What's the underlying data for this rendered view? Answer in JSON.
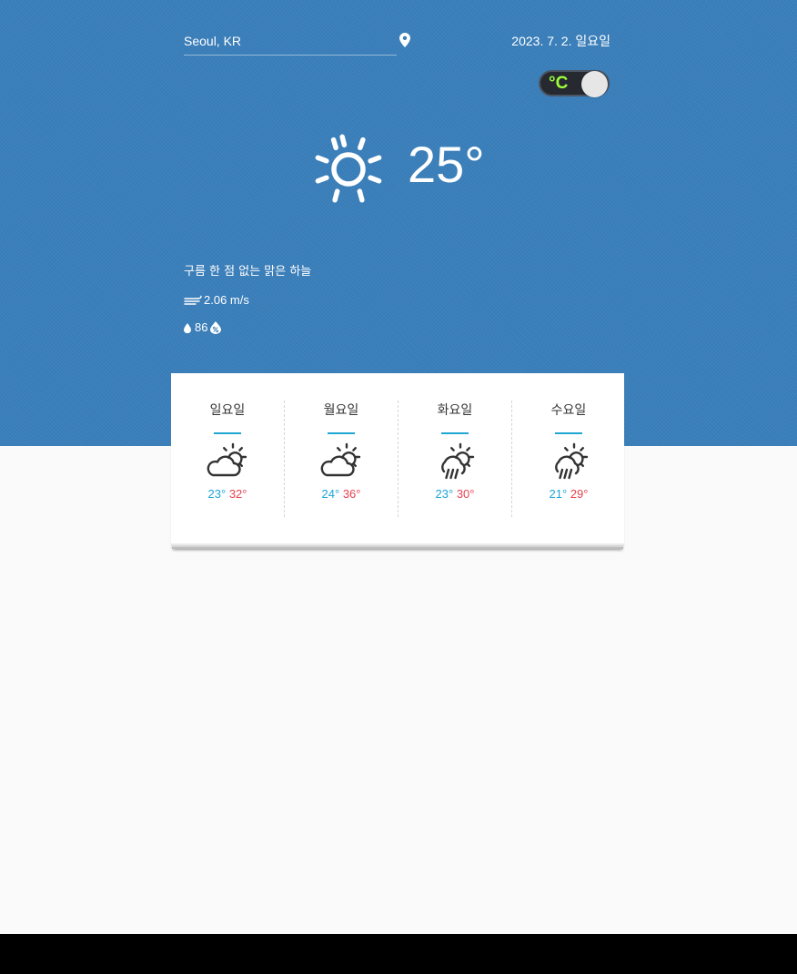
{
  "location": {
    "value": "Seoul, KR",
    "pin_icon": "map-pin-icon"
  },
  "date": "2023. 7. 2. 일요일",
  "unit_toggle": {
    "label": "°C",
    "state": "celsius",
    "label_color": "#9dff3b"
  },
  "current": {
    "icon": "sun-icon",
    "temperature": "25°",
    "description": "구름 한 점 없는 맑은 하늘",
    "wind_icon": "wind-icon",
    "wind": "2.06 m/s",
    "humidity_icon": "droplet-icon",
    "humidity": "86",
    "humidity_unit_icon": "percent-drop-icon"
  },
  "forecast": [
    {
      "day": "일요일",
      "icon": "partly-cloudy-icon",
      "low": "23°",
      "high": "32°"
    },
    {
      "day": "월요일",
      "icon": "partly-cloudy-icon",
      "low": "24°",
      "high": "36°"
    },
    {
      "day": "화요일",
      "icon": "rain-sun-icon",
      "low": "23°",
      "high": "30°"
    },
    {
      "day": "수요일",
      "icon": "rain-sun-icon",
      "low": "21°",
      "high": "29°"
    }
  ],
  "colors": {
    "hero_background": "#3a7fbb",
    "page_background": "#fafafa",
    "accent": "#1fa6d3",
    "low_temp": "#1ea5d4",
    "high_temp": "#e8414f"
  }
}
